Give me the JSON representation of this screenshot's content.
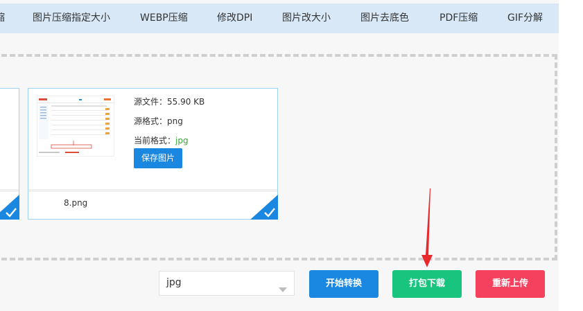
{
  "nav": {
    "items": [
      {
        "label": "缩"
      },
      {
        "label": "图片压缩指定大小"
      },
      {
        "label": "WEBP压缩"
      },
      {
        "label": "修改DPI"
      },
      {
        "label": "图片改大小"
      },
      {
        "label": "图片去底色"
      },
      {
        "label": "PDF压缩"
      },
      {
        "label": "GIF分解"
      }
    ]
  },
  "card": {
    "source_file_label": "源文件：",
    "source_file_value": "55.90 KB",
    "source_format_label": "源格式：",
    "source_format_value": "png",
    "current_format_label": "当前格式：",
    "current_format_value": "jpg",
    "save_button": "保存图片",
    "filename": "8.png"
  },
  "controls": {
    "format_select_value": "jpg",
    "start_button": "开始转换",
    "pack_button": "打包下载",
    "reupload_button": "重新上传"
  },
  "colors": {
    "nav_bg": "#d8e8f7",
    "accent_blue": "#1a87e0",
    "green": "#19c47f",
    "red": "#f5415e",
    "arrow_red": "#e8282d",
    "current_format_green": "#3aa33a"
  },
  "icons": {
    "check": "check-icon",
    "caret": "chevron-down-icon",
    "arrow": "annotation-arrow"
  }
}
